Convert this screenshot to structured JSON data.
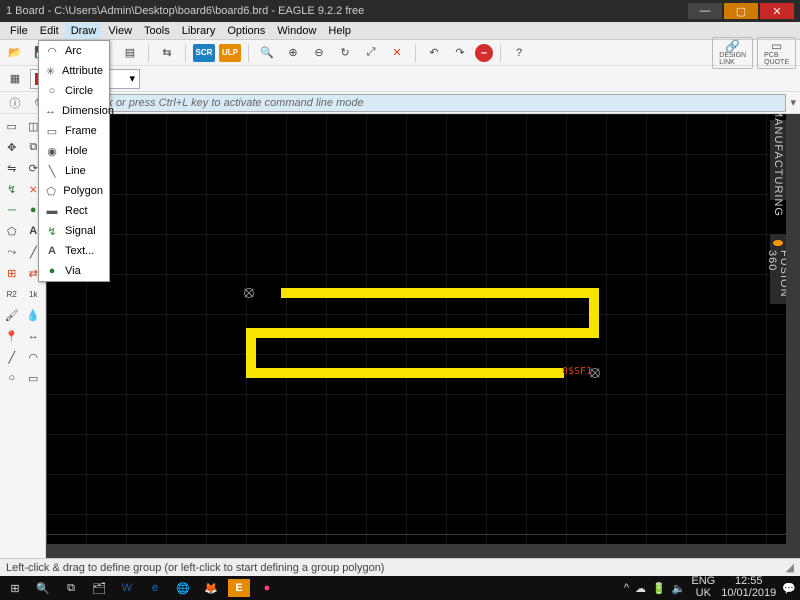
{
  "title": "1 Board - C:\\Users\\Admin\\Desktop\\board6\\board6.brd - EAGLE 9.2.2 free",
  "menu": {
    "file": "File",
    "edit": "Edit",
    "draw": "Draw",
    "view": "View",
    "tools": "Tools",
    "library": "Library",
    "options": "Options",
    "window": "Window",
    "help": "Help"
  },
  "draw_menu": [
    "Arc",
    "Attribute",
    "Circle",
    "Dimension",
    "Frame",
    "Hole",
    "Line",
    "Polygon",
    "Rect",
    "Signal",
    "Text...",
    "Via"
  ],
  "toolbar_labels": {
    "scr": "SCR",
    "ulp": "ULP",
    "design_link": "DESIGN\nLINK",
    "pcb_quote": "PCB\nQUOTE"
  },
  "cmdline_placeholder": "Click or press Ctrl+L key to activate command line mode",
  "right_tabs": {
    "manufacturing": "MANUFACTURING",
    "fusion": "FUSION 360"
  },
  "canvas": {
    "net_label": "0$SF1"
  },
  "status": "Left-click & drag to define group (or left-click to start defining a group polygon)",
  "tray": {
    "lang1": "ENG",
    "lang2": "UK",
    "time": "12:55",
    "date": "10/01/2019"
  }
}
